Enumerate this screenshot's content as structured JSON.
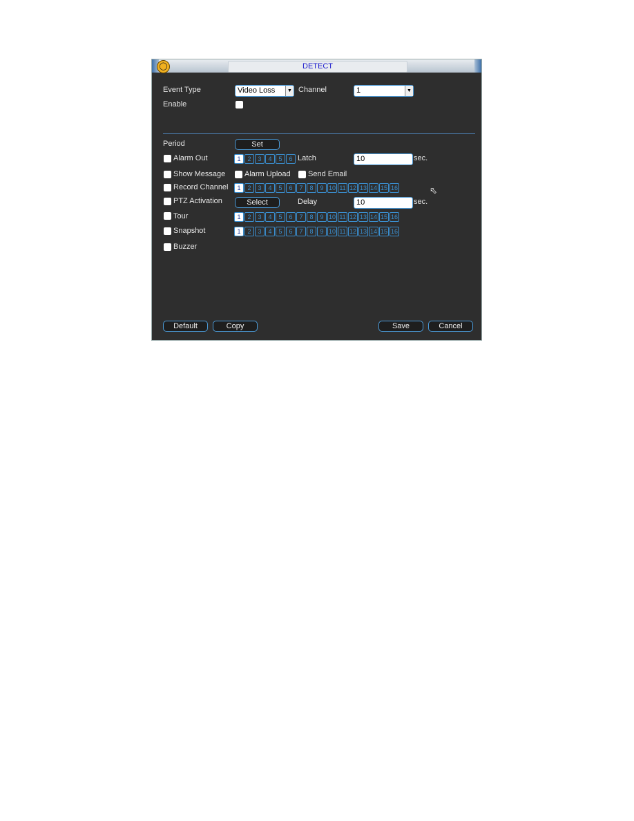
{
  "window": {
    "title": "DETECT",
    "icon": "pedestrian-alarm-icon"
  },
  "event_type": {
    "label": "Event Type",
    "value": "Video Loss"
  },
  "channel": {
    "label": "Channel",
    "value": "1"
  },
  "enable": {
    "label": "Enable",
    "checked": false
  },
  "period": {
    "label": "Period",
    "button": "Set"
  },
  "alarm_out": {
    "label": "Alarm Out",
    "checked": false,
    "channels": [
      "1",
      "2",
      "3",
      "4",
      "5",
      "6"
    ],
    "selected": [
      "1"
    ]
  },
  "latch": {
    "label": "Latch",
    "value": "10",
    "unit": "sec."
  },
  "show_message": {
    "label": "Show Message",
    "checked": false
  },
  "alarm_upload": {
    "label": "Alarm Upload",
    "checked": false
  },
  "send_email": {
    "label": "Send Email",
    "checked": false
  },
  "record_channel": {
    "label": "Record Channel",
    "checked": false,
    "selected": [
      "1"
    ]
  },
  "ptz_activation": {
    "label": "PTZ Activation",
    "checked": false,
    "button": "Select"
  },
  "delay": {
    "label": "Delay",
    "value": "10",
    "unit": "sec."
  },
  "tour": {
    "label": "Tour",
    "checked": false,
    "selected": [
      "1"
    ]
  },
  "snapshot": {
    "label": "Snapshot",
    "checked": false,
    "selected": [
      "1"
    ]
  },
  "buzzer": {
    "label": "Buzzer",
    "checked": false
  },
  "channels16": [
    "1",
    "2",
    "3",
    "4",
    "5",
    "6",
    "7",
    "8",
    "9",
    "10",
    "11",
    "12",
    "13",
    "14",
    "15",
    "16"
  ],
  "buttons": {
    "default": "Default",
    "copy": "Copy",
    "save": "Save",
    "cancel": "Cancel"
  }
}
